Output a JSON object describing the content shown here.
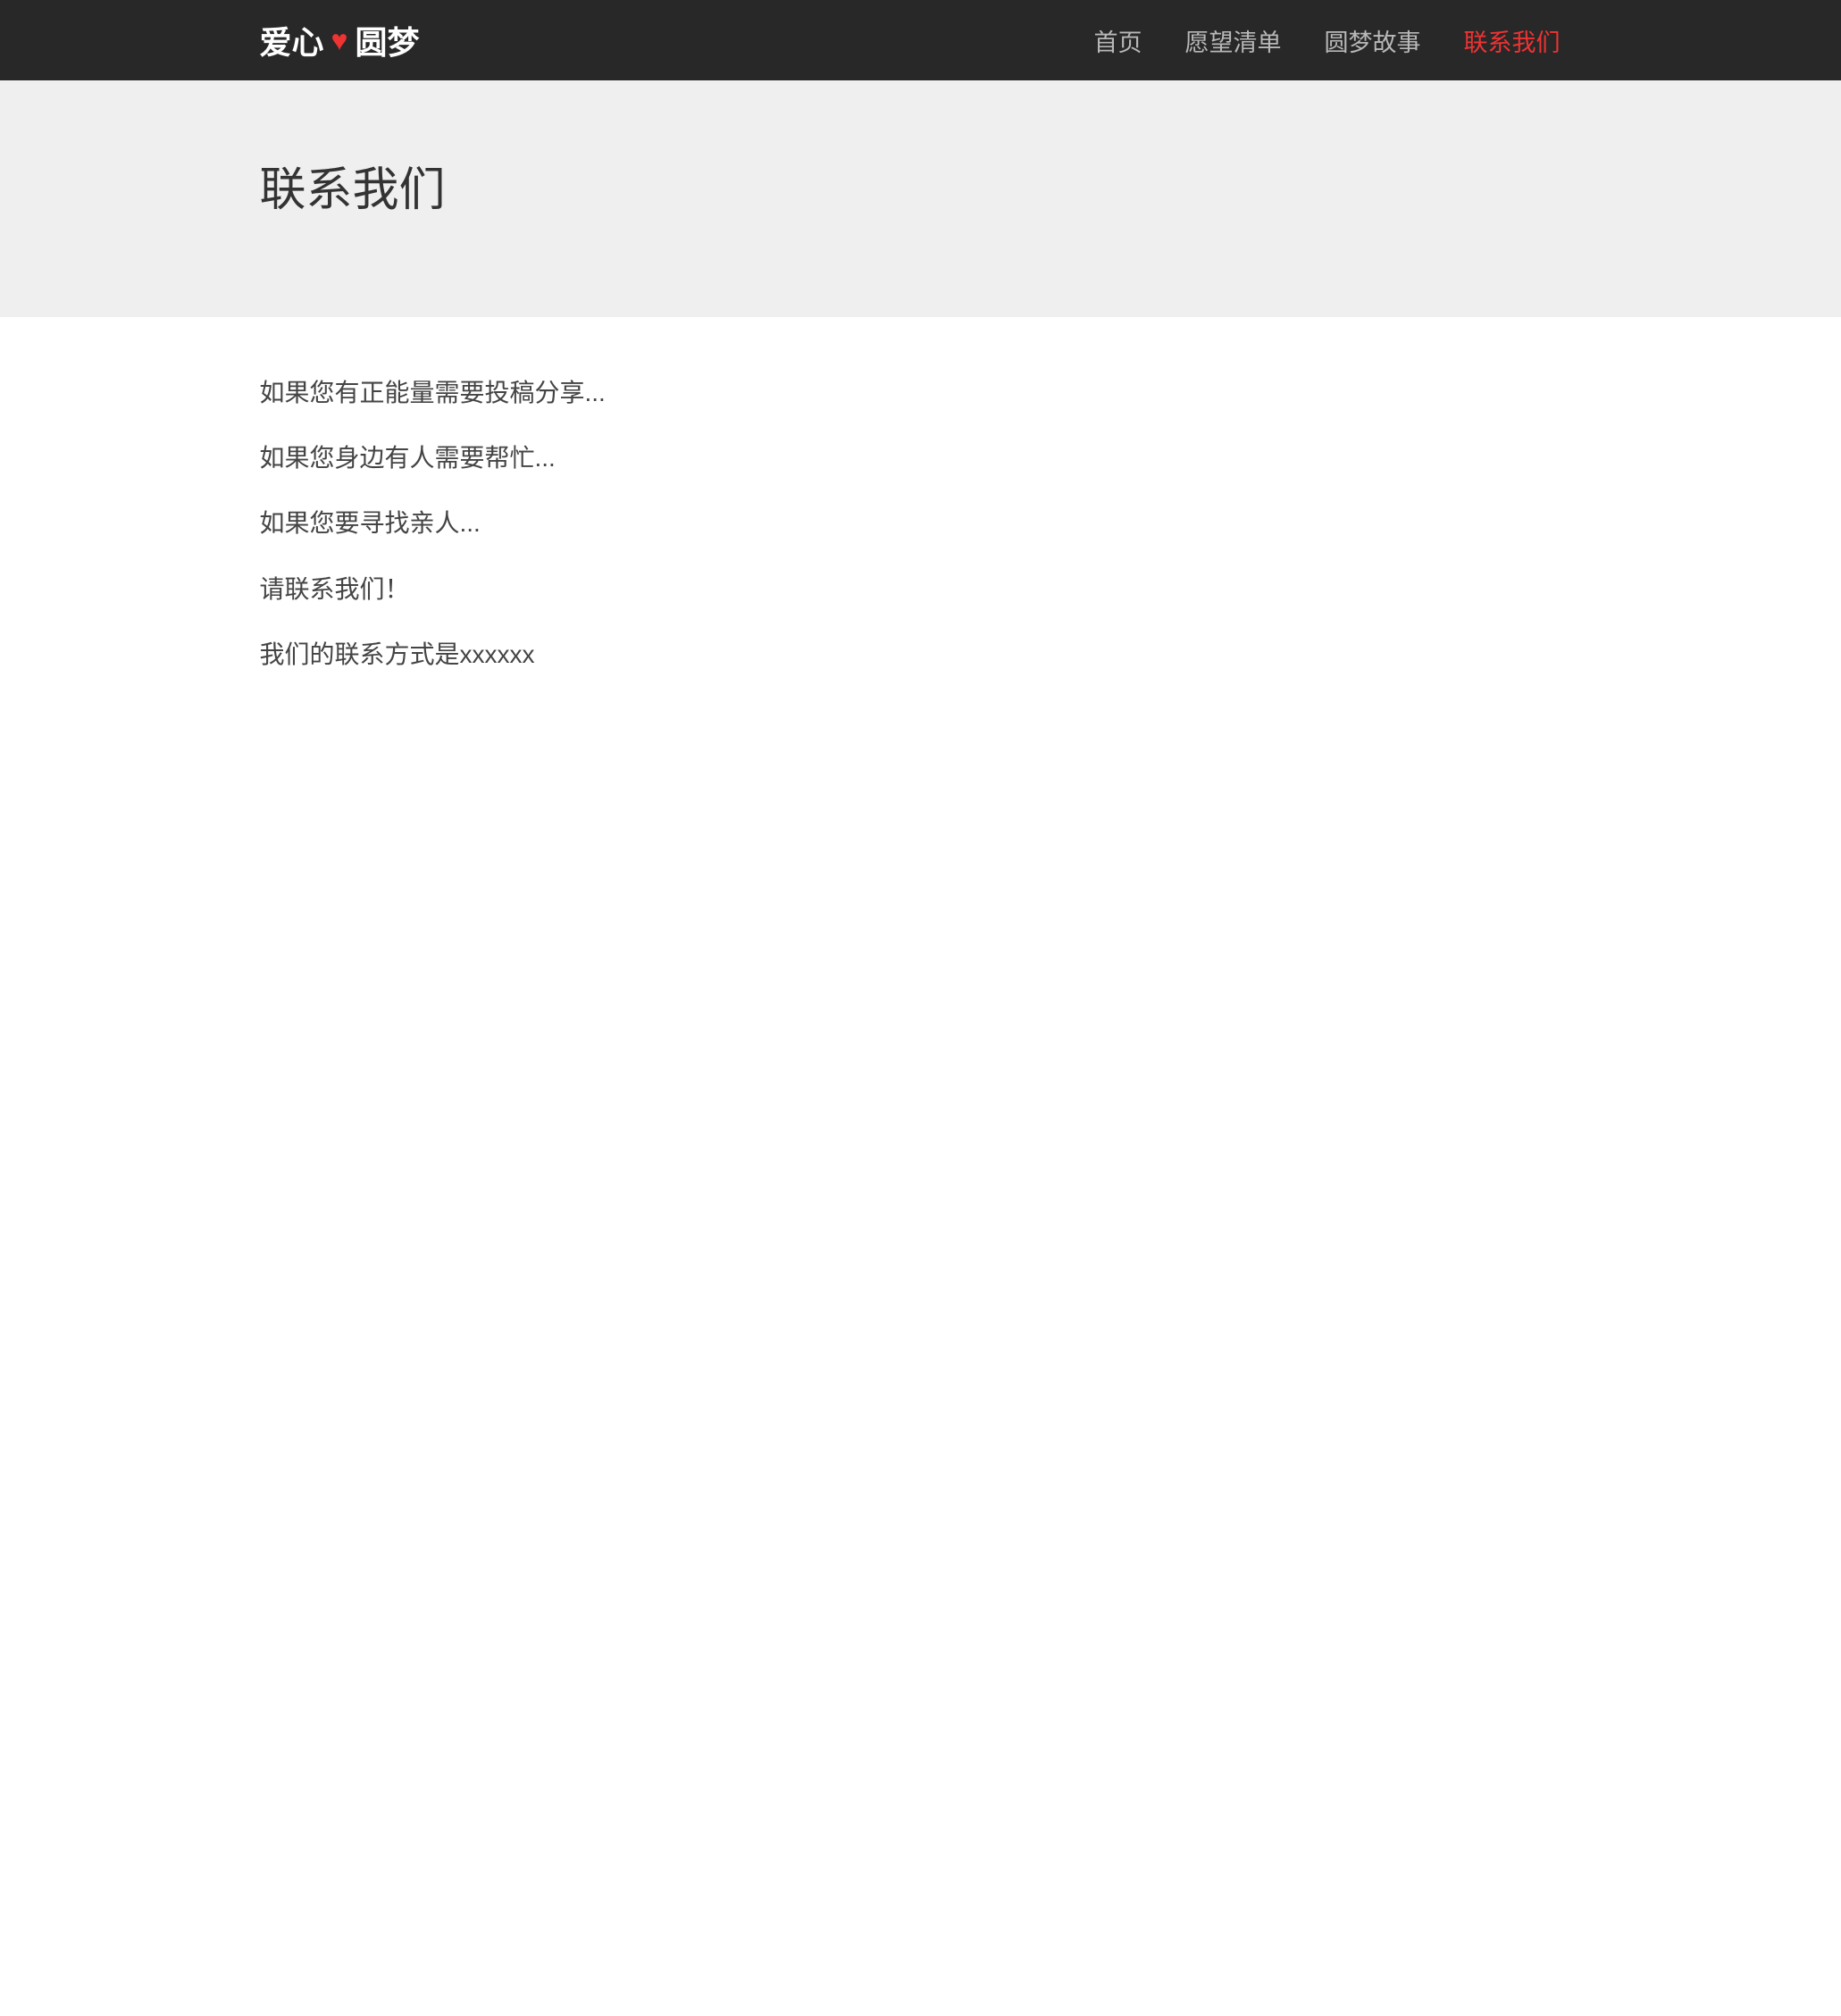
{
  "brand": {
    "text_left": "爱心",
    "heart": "♥",
    "text_right": "圆梦"
  },
  "nav": {
    "items": [
      {
        "label": "首页",
        "active": false
      },
      {
        "label": "愿望清单",
        "active": false
      },
      {
        "label": "圆梦故事",
        "active": false
      },
      {
        "label": "联系我们",
        "active": true
      }
    ]
  },
  "page": {
    "title": "联系我们"
  },
  "content": {
    "paragraphs": [
      "如果您有正能量需要投稿分享...",
      "如果您身边有人需要帮忙...",
      "如果您要寻找亲人...",
      "请联系我们！",
      "我们的联系方式是xxxxxx"
    ]
  }
}
